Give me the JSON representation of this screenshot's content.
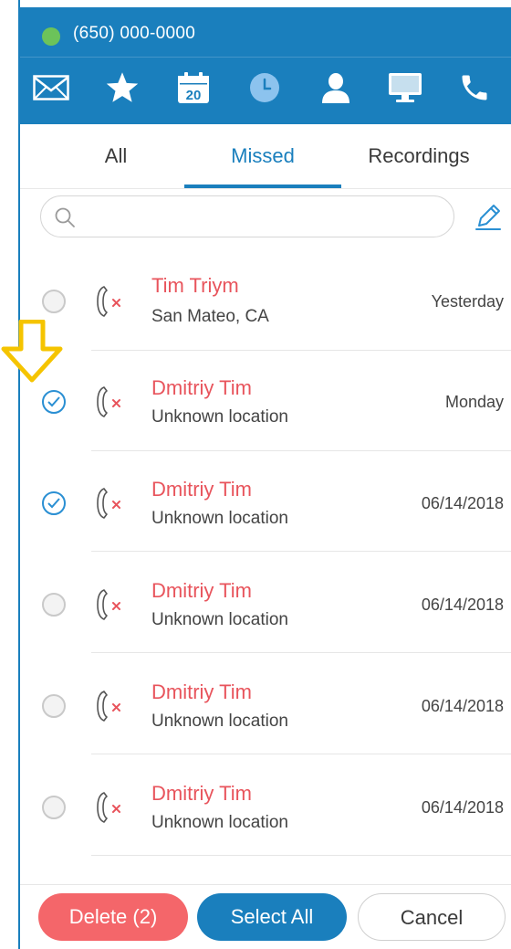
{
  "header": {
    "phone_number": "(650) 000-0000",
    "status_color": "#6cc35a",
    "nav_icons": [
      "message-icon",
      "star-icon",
      "calendar-icon",
      "clock-icon",
      "contacts-icon",
      "computer-icon",
      "phone-icon"
    ],
    "calendar_day": "20",
    "active_icon": "clock-icon"
  },
  "tabs": [
    {
      "label": "All",
      "active": false
    },
    {
      "label": "Missed",
      "active": true
    },
    {
      "label": "Recordings",
      "active": false
    }
  ],
  "search": {
    "placeholder": "",
    "value": ""
  },
  "calls": [
    {
      "name": "Tim Triym",
      "location": "San Mateo, CA",
      "date": "Yesterday",
      "selected": false
    },
    {
      "name": "Dmitriy Tim",
      "location": "Unknown location",
      "date": "Monday",
      "selected": true
    },
    {
      "name": "Dmitriy Tim",
      "location": "Unknown location",
      "date": "06/14/2018",
      "selected": true
    },
    {
      "name": "Dmitriy Tim",
      "location": "Unknown location",
      "date": "06/14/2018",
      "selected": false
    },
    {
      "name": "Dmitriy Tim",
      "location": "Unknown location",
      "date": "06/14/2018",
      "selected": false
    },
    {
      "name": "Dmitriy Tim",
      "location": "Unknown location",
      "date": "06/14/2018",
      "selected": false
    }
  ],
  "footer": {
    "delete_label": "Delete (2)",
    "select_all_label": "Select All",
    "cancel_label": "Cancel"
  },
  "colors": {
    "brand_blue": "#1a7fbd",
    "missed_red": "#e8545c",
    "delete_red": "#f4666a",
    "annotation_arrow": "#f5c400"
  }
}
